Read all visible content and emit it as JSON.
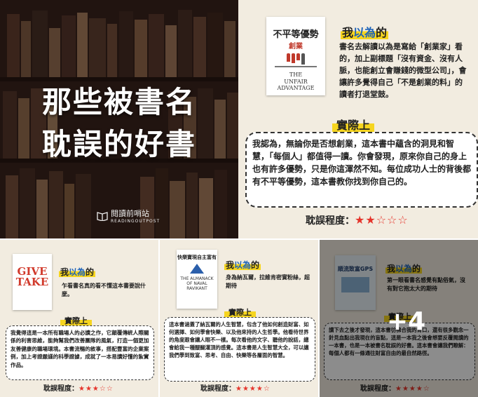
{
  "hero": {
    "title_line1": "那些被書名",
    "title_line2": "耽誤的好書",
    "logo_name": "閱讀前哨站",
    "logo_sub": "READINGOUTPOST"
  },
  "main": {
    "cover_title": "不平等優勢",
    "cover_sub": "創業",
    "cover_en1": "THE",
    "cover_en2": "UNFAIR",
    "cover_en3": "ADVANTAGE",
    "heading": "我以為的",
    "heading_blue": "以為",
    "heading_pre": "我",
    "heading_post": "的",
    "intro": "書名去解讀以為是寫給「創業家」看的，加上副標題「沒有資金、沒有人脈，也能創立會賺錢的微型公司」，會讓許多覺得自己「不是創業的料」的讀者打退堂鼓。",
    "actual_label": "實際上",
    "actual_text": "我認為，無論你是否想創業，這本書中蘊含的洞見和智慧，「每個人」都值得一讀。你會發現，原來你自己的身上也有許多優勢，只是你這渾然不知。每位成功人士的背後都有不平等優勢，這本書教你找到你自己的。",
    "rating_label": "耽誤程度：",
    "stars": "★★☆☆☆"
  },
  "card1": {
    "cover": "GIVE TAKE",
    "heading_pre": "我",
    "heading_blue": "以為",
    "heading_post": "的",
    "intro": "乍看書名真的看不懂這本書要說什麼。",
    "actual_label": "實際上",
    "actual_text": "我覺得這是一本所有職場人的必讀之作，它顛覆傳統人際關係的利害思維，能夠幫我們改善團隊的風氣，打造一個更加友善健康的職場環境。本書流暢的敘事，搭配豐富的企業案例，加上考證嚴謹的科學證據，成就了一本易讀好懂的紮實作品。",
    "rating_label": "耽誤程度：",
    "stars": "★★★☆☆"
  },
  "card2": {
    "cover_title": "快樂寶現自主富有",
    "cover_en": "THE ALMANACK OF NAVAL RAVIKANT",
    "heading_pre": "我",
    "heading_blue": "以為",
    "heading_post": "的",
    "intro": "身為納瓦爾，拉維肯密實粉絲，超期待",
    "actual_label": "實際上",
    "actual_text": "這本書涵蓋了納瓦爾的人生智慧，包含了他如何創造財富、如何選擇、如何學會快樂、以及他來持的人生哲學。他看待世界的角度跟會讓人眼不一樣。每次看他的文字、聽他的說話，總會給我一種醍醐灌頂的感覺。這本書是人生智慧大全，可以讓我們學到致富、思考、自由、快樂等各層面的智慧。",
    "rating_label": "耽誤程度：",
    "stars": "★★★★☆"
  },
  "card3": {
    "cover_title": "順流致富GPS",
    "heading_pre": "我",
    "heading_blue": "以為",
    "heading_post": "的",
    "intro": "第一眼看書名感覺有點俗氣，沒有對它抱太大的期待",
    "actual_label": "實際上",
    "actual_text": "讀下去之後才發現，這本書彷彿合我的胃口，還有很多觀念一針見血點出我現在的盲點，這是一本我之後會想要反覆閱讀的一本書，也是一本被書名耽誤的好書。這本書會讓我們瞭解：每個人都有一條通往財富自由的最自然路徑。",
    "rating_label": "耽誤程度：",
    "stars": "★★★★☆"
  },
  "more": "+4"
}
